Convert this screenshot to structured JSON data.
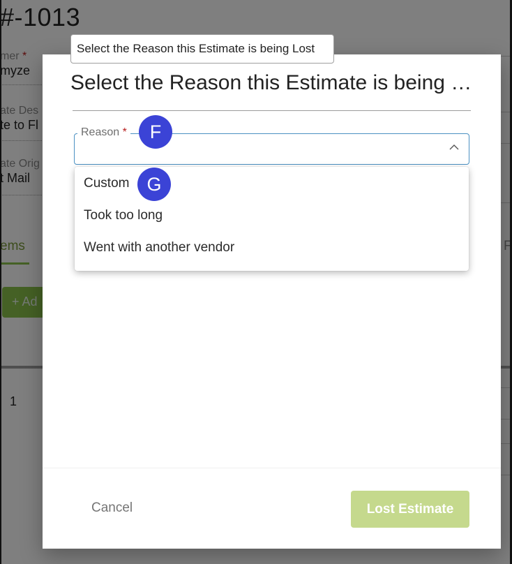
{
  "background": {
    "title": "#-1013",
    "fields": [
      {
        "label": "mer",
        "required_mark": "*",
        "value": "myze"
      },
      {
        "label": "ate Des",
        "required_mark": "",
        "value": "te to Fl"
      },
      {
        "label": "ate Orig",
        "required_mark": "",
        "value": "t Mail"
      }
    ],
    "tab_label": "ems",
    "tab_right_label": "F",
    "add_button": "+ Ad",
    "row_number": "1"
  },
  "tooltip": {
    "text": "Select the Reason this Estimate is being Lost"
  },
  "dialog": {
    "title": "Select the Reason this Estimate is being Lost",
    "reason_field": {
      "label": "Reason",
      "required_mark": "*",
      "value": "",
      "chevron_icon": "chevron-up-icon"
    },
    "options": [
      {
        "label": "Custom"
      },
      {
        "label": "Took too long"
      },
      {
        "label": "Went with another vendor"
      }
    ],
    "cancel_label": "Cancel",
    "submit_label": "Lost Estimate"
  },
  "markers": {
    "f": "F",
    "g": "G"
  },
  "colors": {
    "accent_blue": "#4a90c2",
    "marker": "#3b43d6",
    "submit_disabled": "#c5d98d",
    "tab_green": "#8bc34a",
    "required_red": "#b71c1c"
  }
}
